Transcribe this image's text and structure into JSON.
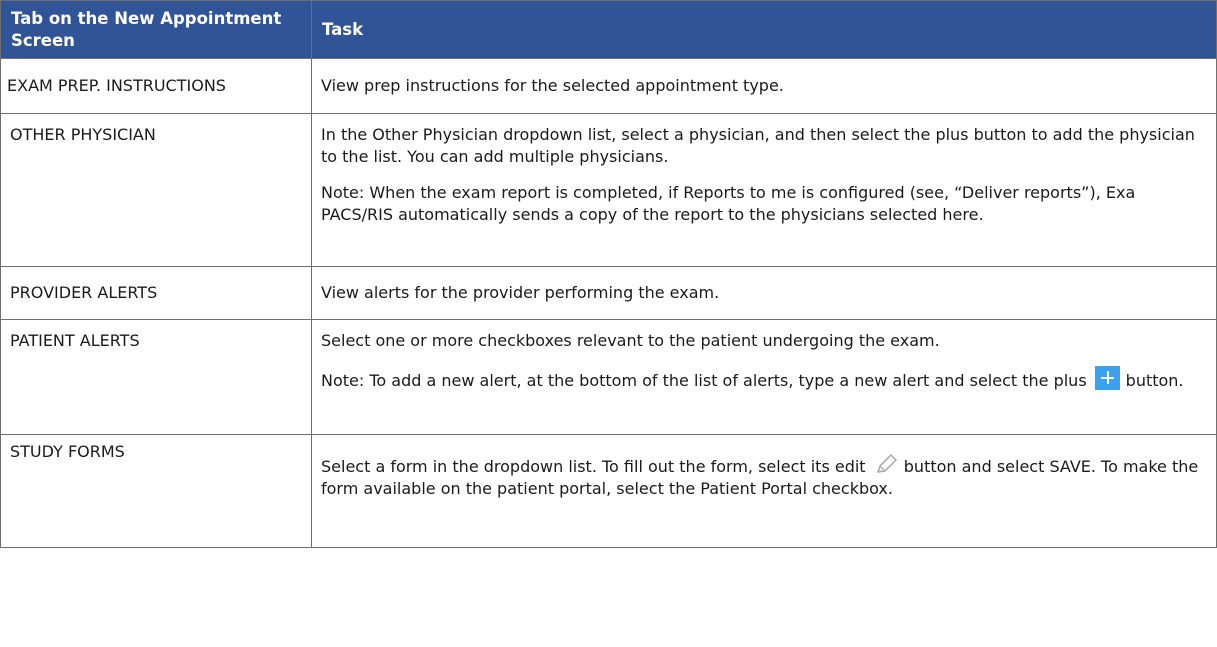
{
  "header": {
    "col1": "Tab on the New Appointment Screen",
    "col2": "Task"
  },
  "rows": [
    {
      "tab": "EXAM PREP. INSTRUCTIONS",
      "task": "View prep instructions for the selected appointment type."
    },
    {
      "tab": "OTHER PHYSICIAN",
      "task": "In the Other Physician dropdown list, select a physician, and then select the plus button to add the physician to the list. You can add multiple physicians.",
      "note": "Note: When the exam report is completed, if Reports to me is configured (see, “Deliver reports”), Exa PACS/RIS automatically sends a copy of the report to the physicians selected here."
    },
    {
      "tab": "PROVIDER ALERTS",
      "task": "View alerts for the provider performing the exam."
    },
    {
      "tab": "PATIENT ALERTS",
      "task": "Select one or more checkboxes relevant to the patient undergoing the exam.",
      "note_pre": "Note: To add a new alert, at the bottom of the list of alerts, type a new alert and select the plus",
      "note_post": "button."
    },
    {
      "tab": "STUDY FORMS",
      "task_pre": "Select a form in the dropdown list. To fill out the form, select its edit",
      "task_post": "button and select SAVE. To make the form available on the patient portal, select the Patient Portal checkbox."
    }
  ],
  "icons": {
    "plus": "plus-button-icon",
    "edit": "pencil-edit-icon"
  },
  "colors": {
    "header_bg": "#305496",
    "plus_button": "#3aa2ee"
  }
}
